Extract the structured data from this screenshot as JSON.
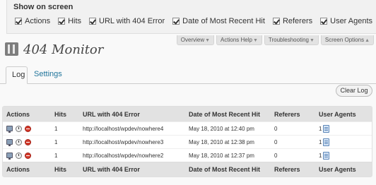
{
  "screen_options": {
    "title": "Show on screen",
    "columns": [
      {
        "label": "Actions",
        "checked": true
      },
      {
        "label": "Hits",
        "checked": true
      },
      {
        "label": "URL with 404 Error",
        "checked": true
      },
      {
        "label": "Date of Most Recent Hit",
        "checked": true
      },
      {
        "label": "Referers",
        "checked": true
      },
      {
        "label": "User Agents",
        "checked": true
      }
    ]
  },
  "meta_tabs": [
    {
      "label": "Overview"
    },
    {
      "label": "Actions Help"
    },
    {
      "label": "Troubleshooting"
    },
    {
      "label": "Screen Options"
    }
  ],
  "page": {
    "title": "404 Monitor",
    "icon": "plugin-icon"
  },
  "tabs": [
    {
      "label": "Log",
      "active": true
    },
    {
      "label": "Settings",
      "active": false
    }
  ],
  "clear_log_label": "Clear Log",
  "table": {
    "headers": [
      "Actions",
      "Hits",
      "URL with 404 Error",
      "Date of Most Recent Hit",
      "Referers",
      "User Agents"
    ],
    "rows": [
      {
        "hits": "1",
        "url": "http://localhost/wpdev/nowhere4",
        "date": "May 18, 2010 at 12:40 pm",
        "referers": "0",
        "user_agents": "1"
      },
      {
        "hits": "1",
        "url": "http://localhost/wpdev/nowhere3",
        "date": "May 18, 2010 at 12:38 pm",
        "referers": "0",
        "user_agents": "1"
      },
      {
        "hits": "1",
        "url": "http://localhost/wpdev/nowhere2",
        "date": "May 18, 2010 at 12:37 pm",
        "referers": "0",
        "user_agents": "1"
      }
    ]
  },
  "icons": {
    "row_actions": [
      "monitor-icon",
      "clock-icon",
      "delete-icon"
    ],
    "user_agent": "document-icon"
  },
  "colors": {
    "link": "#21759b",
    "delete": "#d23a2b",
    "header_bg": "#e2e2e2"
  }
}
